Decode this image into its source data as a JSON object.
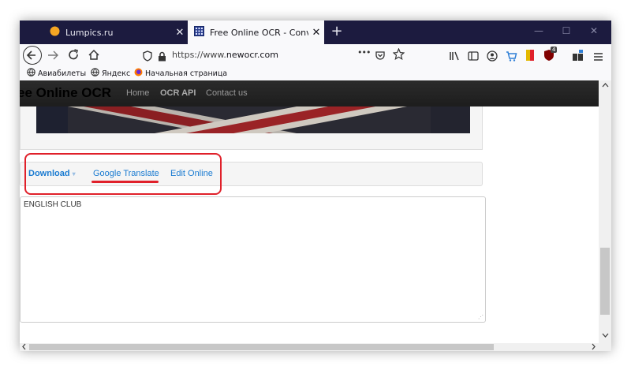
{
  "browser": {
    "tabs": [
      {
        "title": "Lumpics.ru",
        "active": false
      },
      {
        "title": "Free Online OCR - Convert JPEG",
        "active": true
      }
    ],
    "new_tab_glyph": "+",
    "close_glyph": "✕",
    "window_controls": {
      "minimize": "—",
      "maximize": "☐",
      "close": "✕"
    },
    "url": {
      "prefix": "https://www.",
      "domain": "newocr.com"
    },
    "page_actions": "•••",
    "bookmarks": [
      {
        "label": "Авиабилеты",
        "icon": "globe-icon"
      },
      {
        "label": "Яндекс",
        "icon": "globe-icon"
      },
      {
        "label": "Начальная страница",
        "icon": "firefox-icon"
      }
    ],
    "badges": {
      "ublock_count": "4"
    }
  },
  "site": {
    "brand": "ee Online OCR",
    "nav": [
      "Home",
      "OCR API",
      "Contact us"
    ],
    "actions": {
      "download": "Download",
      "download_caret": "▾",
      "google_translate": "Google Translate",
      "edit_online": "Edit Online"
    },
    "result_text": "ENGLISH CLUB"
  },
  "colors": {
    "titlebar": "#1c1b3f",
    "highlight": "#e0202a",
    "link": "#1a7bd1"
  }
}
